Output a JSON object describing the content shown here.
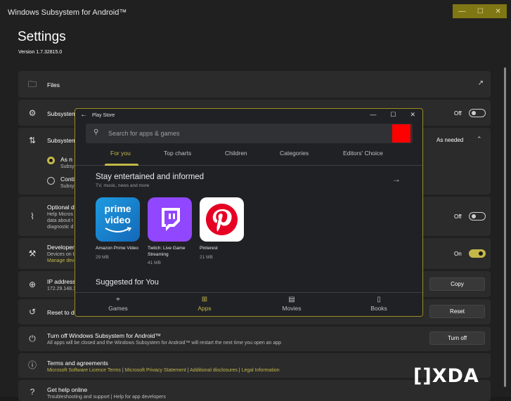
{
  "window": {
    "title": "Windows Subsystem for Android™",
    "controls": [
      "—",
      "☐",
      "✕"
    ]
  },
  "settings": {
    "heading": "Settings",
    "version": "Version 1.7.32815.0",
    "rows": {
      "files": {
        "label": "Files"
      },
      "subsystem_resources": {
        "label": "Subsystem",
        "toggle_label": "Off",
        "toggle_on": false
      },
      "subsystem_expand": {
        "label": "Subsystem",
        "value": "As needed"
      },
      "radio1": {
        "label": "As n",
        "sub": "Subsy"
      },
      "radio2": {
        "label": "Conti",
        "sub": "Subsy"
      },
      "optional": {
        "label": "Optional d",
        "sub1": "Help Micros",
        "sub2": "data about t",
        "sub3": "diagnostic d",
        "toggle_label": "Off",
        "toggle_on": false
      },
      "developer": {
        "label": "Developer",
        "sub1": "Devices on t",
        "link": "Manage dev",
        "toggle_label": "On",
        "toggle_on": true
      },
      "ip": {
        "label": "IP address",
        "sub": "172.29.148.1",
        "button": "Copy"
      },
      "reset": {
        "label": "Reset to de",
        "button": "Reset"
      },
      "turnoff": {
        "label": "Turn off Windows Subsystem for Android™",
        "sub": "All apps will be closed and the Windows Subsystem for Android™ will restart the next time you open an app",
        "button": "Turn off"
      },
      "terms": {
        "label": "Terms and agreements",
        "link1": "Microsoft Software Licence Terms",
        "link2": "Microsoft Privacy Statement",
        "link3": "Additional disclosures",
        "link4": "Legal Information",
        "sep": "|"
      },
      "help": {
        "label": "Get help online",
        "sub": "Troubleshooting and support | Help for app developers"
      }
    }
  },
  "playstore": {
    "title": "Play Store",
    "back": "←",
    "controls": [
      "—",
      "☐",
      "✕"
    ],
    "search_placeholder": "Search for apps & games",
    "tabs": [
      "For you",
      "Top charts",
      "Children",
      "Categories",
      "Editors' Choice"
    ],
    "active_tab": "For you",
    "section_title": "Stay entertained and informed",
    "section_sub": "TV, music, news and more",
    "apps": [
      {
        "name": "Amazon Prime Video",
        "size": "29 MB",
        "tile_text_1": "prime",
        "tile_text_2": "video"
      },
      {
        "name": "Twitch: Live Game Streaming",
        "size": "41 MB"
      },
      {
        "name": "Pinterest",
        "size": "21 MB"
      }
    ],
    "suggested": "Suggested for You",
    "nav": [
      "Games",
      "Apps",
      "Movies",
      "Books"
    ],
    "active_nav": "Apps"
  },
  "watermark": "XDA",
  "colors": {
    "accent": "#c4b849",
    "background": "#202020",
    "row": "#2b2b2b",
    "playstore_bg": "#202124",
    "red_box": "#ff0000"
  }
}
